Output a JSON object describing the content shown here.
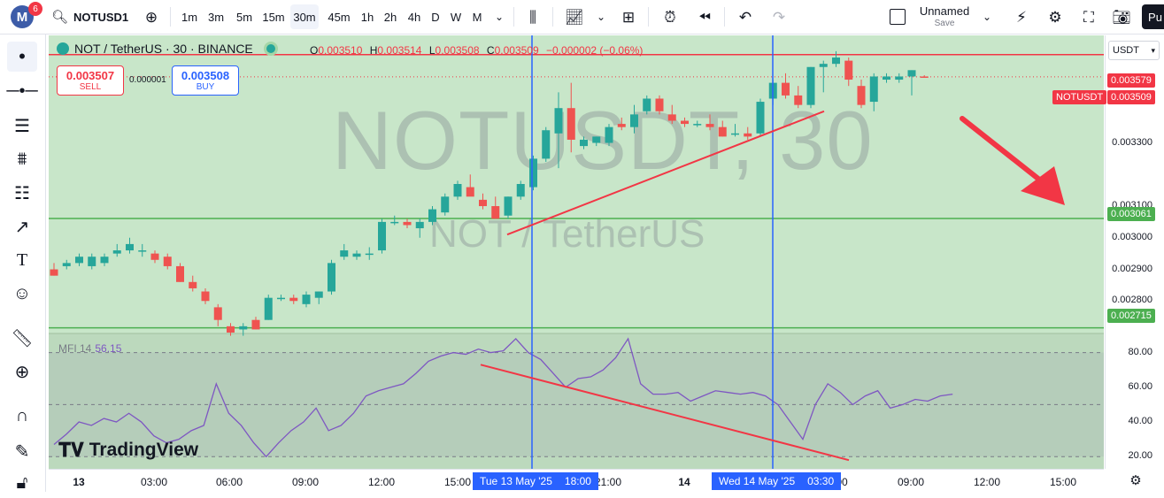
{
  "topbar": {
    "notifications": "6",
    "symbol": "NOTUSD1",
    "intervals": [
      "1m",
      "3m",
      "5m",
      "15m",
      "30m",
      "45m",
      "1h",
      "2h",
      "4h",
      "D",
      "W",
      "M"
    ],
    "active_interval": "30m",
    "layout_name": "Unnamed",
    "save_label": "Save",
    "publish_label": "Pu"
  },
  "legend": {
    "title": "NOT / TetherUS · 30 · BINANCE",
    "o_label": "O",
    "o": "0.003510",
    "h_label": "H",
    "h": "0.003514",
    "l_label": "L",
    "l": "0.003508",
    "c_label": "C",
    "c": "0.003509",
    "change": "−0.000002 (−0.06%)"
  },
  "trade": {
    "sell_price": "0.003507",
    "sell_label": "SELL",
    "spread": "0.000001",
    "buy_price": "0.003508",
    "buy_label": "BUY"
  },
  "watermark": {
    "symbol": "NOTUSDT, 30",
    "pair": "NOT / TetherUS"
  },
  "price_scale": {
    "currency": "USDT",
    "ticks": [
      "0.003300",
      "0.003100",
      "0.003000",
      "0.002900",
      "0.002800"
    ],
    "labels": {
      "red_line": "0.003579",
      "symbol_tag": "NOTUSDT",
      "last_price": "0.003509",
      "green_upper": "0.003061",
      "green_lower": "0.002715"
    }
  },
  "mfi": {
    "label": "MFI 14",
    "value": "56.15",
    "ticks": [
      "80.00",
      "60.00",
      "40.00",
      "20.00"
    ]
  },
  "time_axis": {
    "ticks": [
      {
        "label": "13",
        "bold": true
      },
      {
        "label": "03:00",
        "bold": false
      },
      {
        "label": "06:00",
        "bold": false
      },
      {
        "label": "09:00",
        "bold": false
      },
      {
        "label": "12:00",
        "bold": false
      },
      {
        "label": "15:00",
        "bold": false
      },
      {
        "label": "21:00",
        "bold": false
      },
      {
        "label": "14",
        "bold": true
      },
      {
        "label": "00",
        "bold": false
      },
      {
        "label": "09:00",
        "bold": false
      },
      {
        "label": "12:00",
        "bold": false
      },
      {
        "label": "15:00",
        "bold": false
      }
    ],
    "cursor1": {
      "date": "Tue 13 May '25",
      "time": "18:00"
    },
    "cursor2": {
      "date": "Wed 14 May '25",
      "time": "03:30"
    }
  },
  "branding": "TradingView",
  "colors": {
    "up": "#26a69a",
    "down": "#ef5350",
    "chart_bg": "#c8e6c9",
    "resistance": "#f23645",
    "support": "#4caf50",
    "cursor": "#2962ff",
    "mfi_line": "#7e57c2"
  },
  "chart_data": {
    "type": "candlestick",
    "candles": [
      [
        0.0029,
        0.00292,
        0.00288,
        0.00288
      ],
      [
        0.00291,
        0.00293,
        0.0029,
        0.00292
      ],
      [
        0.00292,
        0.00295,
        0.00291,
        0.00294
      ],
      [
        0.00291,
        0.00295,
        0.0029,
        0.00294
      ],
      [
        0.00292,
        0.00295,
        0.00291,
        0.00294
      ],
      [
        0.00295,
        0.00298,
        0.00294,
        0.00296
      ],
      [
        0.00296,
        0.003,
        0.00295,
        0.00298
      ],
      [
        0.00296,
        0.00298,
        0.00294,
        0.00296
      ],
      [
        0.00295,
        0.00296,
        0.00292,
        0.00293
      ],
      [
        0.00294,
        0.00295,
        0.0029,
        0.00291
      ],
      [
        0.00291,
        0.00292,
        0.00286,
        0.00286
      ],
      [
        0.00286,
        0.00288,
        0.00283,
        0.00284
      ],
      [
        0.00283,
        0.00284,
        0.00279,
        0.0028
      ],
      [
        0.00278,
        0.00279,
        0.00272,
        0.00274
      ],
      [
        0.00272,
        0.00273,
        0.00269,
        0.0027
      ],
      [
        0.00271,
        0.00273,
        0.00269,
        0.00272
      ],
      [
        0.00274,
        0.00275,
        0.00271,
        0.00271
      ],
      [
        0.00274,
        0.00282,
        0.00274,
        0.00281
      ],
      [
        0.00281,
        0.00282,
        0.0028,
        0.00281
      ],
      [
        0.00281,
        0.00282,
        0.00279,
        0.0028
      ],
      [
        0.00279,
        0.00283,
        0.00278,
        0.00282
      ],
      [
        0.00281,
        0.00283,
        0.00279,
        0.00283
      ],
      [
        0.00283,
        0.00293,
        0.00282,
        0.00292
      ],
      [
        0.00294,
        0.00298,
        0.00293,
        0.00296
      ],
      [
        0.00294,
        0.00296,
        0.00293,
        0.00295
      ],
      [
        0.00295,
        0.00297,
        0.00293,
        0.00295
      ],
      [
        0.00296,
        0.00306,
        0.00295,
        0.00305
      ],
      [
        0.00305,
        0.00307,
        0.00304,
        0.00305
      ],
      [
        0.00305,
        0.00306,
        0.00303,
        0.00304
      ],
      [
        0.00303,
        0.00306,
        0.003,
        0.00305
      ],
      [
        0.00305,
        0.0031,
        0.00304,
        0.00309
      ],
      [
        0.00308,
        0.00314,
        0.00307,
        0.00313
      ],
      [
        0.00313,
        0.00318,
        0.00312,
        0.00317
      ],
      [
        0.00316,
        0.0032,
        0.00315,
        0.00313
      ],
      [
        0.00312,
        0.00314,
        0.00309,
        0.0031
      ],
      [
        0.0031,
        0.00313,
        0.00306,
        0.00306
      ],
      [
        0.00307,
        0.00313,
        0.00306,
        0.00313
      ],
      [
        0.00313,
        0.00318,
        0.00312,
        0.00317
      ],
      [
        0.00316,
        0.00326,
        0.00315,
        0.00325
      ],
      [
        0.00325,
        0.00335,
        0.00324,
        0.00334
      ],
      [
        0.00333,
        0.00346,
        0.00322,
        0.00341
      ],
      [
        0.00341,
        0.00349,
        0.00327,
        0.00331
      ],
      [
        0.00329,
        0.00332,
        0.00328,
        0.00331
      ],
      [
        0.0033,
        0.00332,
        0.00329,
        0.00332
      ],
      [
        0.0033,
        0.00336,
        0.00329,
        0.00335
      ],
      [
        0.00336,
        0.00338,
        0.00334,
        0.00335
      ],
      [
        0.00335,
        0.00342,
        0.00333,
        0.00339
      ],
      [
        0.0034,
        0.00345,
        0.00339,
        0.00344
      ],
      [
        0.00344,
        0.00345,
        0.00339,
        0.0034
      ],
      [
        0.00339,
        0.00342,
        0.00336,
        0.00337
      ],
      [
        0.00337,
        0.00338,
        0.00335,
        0.00336
      ],
      [
        0.00336,
        0.00337,
        0.00335,
        0.00336
      ],
      [
        0.00336,
        0.00339,
        0.00334,
        0.00335
      ],
      [
        0.00335,
        0.00337,
        0.00332,
        0.00332
      ],
      [
        0.00333,
        0.00336,
        0.00332,
        0.00333
      ],
      [
        0.00333,
        0.00335,
        0.00331,
        0.00332
      ],
      [
        0.00333,
        0.00344,
        0.00332,
        0.00343
      ],
      [
        0.00344,
        0.0035,
        0.00342,
        0.00349
      ],
      [
        0.00349,
        0.00352,
        0.00344,
        0.00345
      ],
      [
        0.00345,
        0.00348,
        0.00341,
        0.00342
      ],
      [
        0.00342,
        0.00354,
        0.00341,
        0.00354
      ],
      [
        0.00354,
        0.00356,
        0.00346,
        0.00355
      ],
      [
        0.00355,
        0.00359,
        0.00354,
        0.00357
      ],
      [
        0.00356,
        0.00357,
        0.00348,
        0.0035
      ],
      [
        0.00348,
        0.0035,
        0.00341,
        0.00342
      ],
      [
        0.00343,
        0.00352,
        0.0034,
        0.00351
      ],
      [
        0.0035,
        0.00352,
        0.00349,
        0.00351
      ],
      [
        0.0035,
        0.00352,
        0.00349,
        0.00351
      ],
      [
        0.00351,
        0.00353,
        0.00345,
        0.00353
      ],
      [
        0.00351,
        0.003514,
        0.003508,
        0.003509
      ]
    ],
    "mfi_values": [
      27,
      33,
      40,
      38,
      42,
      40,
      45,
      40,
      32,
      28,
      30,
      35,
      38,
      62,
      45,
      38,
      28,
      20,
      28,
      35,
      40,
      48,
      35,
      38,
      45,
      55,
      58,
      60,
      62,
      68,
      75,
      78,
      80,
      79,
      82,
      80,
      81,
      88,
      80,
      76,
      68,
      60,
      65,
      66,
      70,
      77,
      88,
      62,
      56,
      56,
      57,
      52,
      55,
      58,
      57,
      56,
      57,
      55,
      50,
      40,
      30,
      50,
      62,
      57,
      50,
      55,
      58,
      48,
      50,
      53,
      52,
      55,
      56
    ],
    "horizontal_levels": {
      "resistance": 0.003579,
      "upper_support": 0.003061,
      "lower_support": 0.002715
    },
    "mfi_levels": [
      80,
      50,
      20
    ],
    "trend_lines": {
      "price": [
        [
          0.00301,
          0.0034
        ]
      ],
      "mfi": [
        [
          73,
          18
        ]
      ]
    },
    "x_tick_labels": [
      "13",
      "03:00",
      "06:00",
      "09:00",
      "12:00",
      "15:00",
      "21:00",
      "14",
      "00",
      "09:00",
      "12:00",
      "15:00"
    ],
    "ylim_price": [
      0.0027,
      0.00364
    ],
    "ylim_mfi": [
      13,
      91
    ]
  }
}
